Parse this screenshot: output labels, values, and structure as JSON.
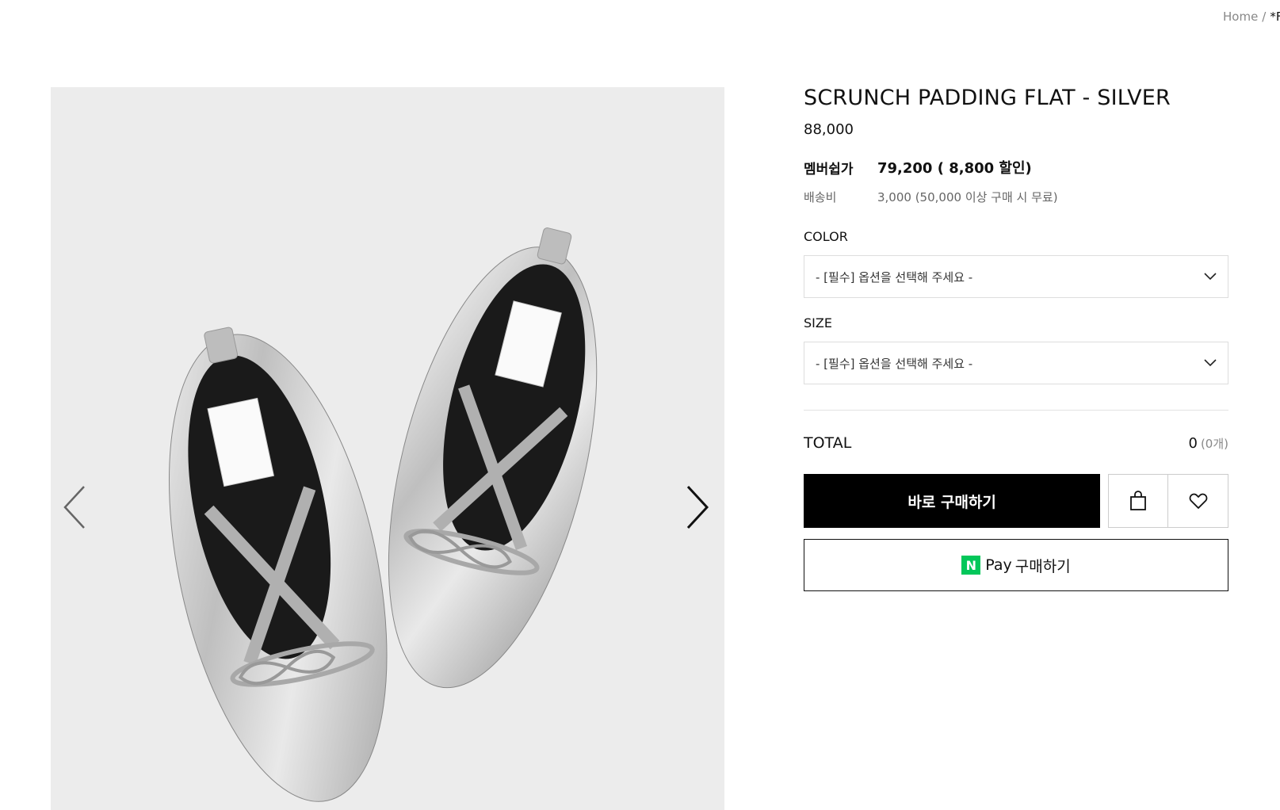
{
  "breadcrumb": {
    "home": "Home",
    "separator": "/",
    "current": "*F"
  },
  "gallery": {
    "image_description_icon": "shoe-photo",
    "prev_icon": "chevron-left-icon",
    "next_icon": "chevron-right-icon"
  },
  "product": {
    "title": "SCRUNCH PADDING FLAT - SILVER",
    "price": "88,000",
    "member_label": "멤버쉽가",
    "member_price": "79,200 ( 8,800 할인)",
    "shipping_label": "배송비",
    "shipping_value": "3,000 (50,000 이상 구매 시 무료)"
  },
  "options": {
    "color_label": "COLOR",
    "color_placeholder": "- [필수] 옵션을 선택해 주세요 -",
    "size_label": "SIZE",
    "size_placeholder": "- [필수] 옵션을 선택해 주세요 -"
  },
  "total": {
    "label": "TOTAL",
    "amount": "0",
    "count": "(0개)"
  },
  "actions": {
    "buy_now": "바로 구매하기",
    "cart_icon": "shopping-bag-icon",
    "wishlist_icon": "heart-icon",
    "npay_logo": "N",
    "npay_pay": "Pay",
    "npay_label": "구매하기"
  },
  "colors": {
    "primary": "#000000",
    "npay_green": "#03c75a",
    "gallery_bg": "#ececec"
  }
}
